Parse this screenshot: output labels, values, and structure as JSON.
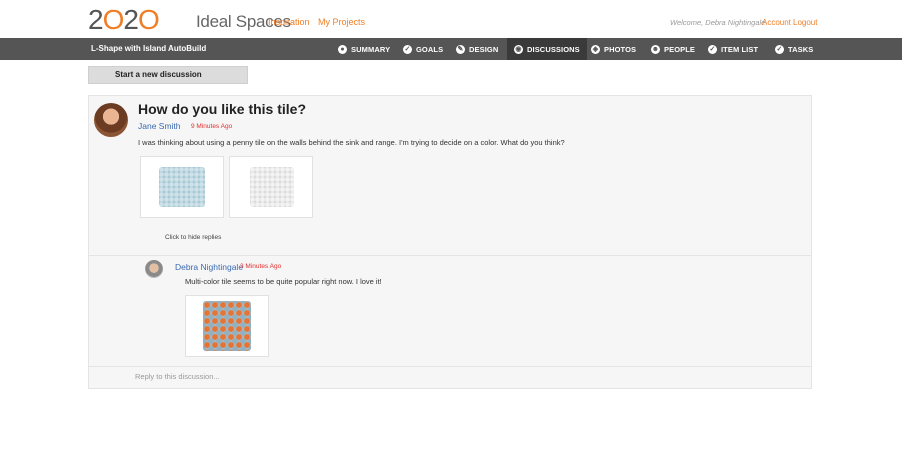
{
  "header": {
    "logo": [
      "2",
      "O",
      "2",
      "O"
    ],
    "brand": "Ideal Spaces",
    "links": [
      "Inspiration",
      "My Projects"
    ],
    "welcome": "Welcome, Debra Nightingale",
    "account": "Account",
    "logout": "Logout"
  },
  "nav": {
    "project": "L-Shape with Island AutoBuild",
    "items": [
      {
        "label": "SUMMARY",
        "icon": "●"
      },
      {
        "label": "GOALS",
        "icon": "✓"
      },
      {
        "label": "DESIGN",
        "icon": "✎"
      },
      {
        "label": "DISCUSSIONS",
        "icon": "◉"
      },
      {
        "label": "PHOTOS",
        "icon": "◈"
      },
      {
        "label": "PEOPLE",
        "icon": "☻"
      },
      {
        "label": "ITEM LIST",
        "icon": "✓"
      },
      {
        "label": "TASKS",
        "icon": "✓"
      }
    ],
    "active": "DISCUSSIONS"
  },
  "actions": {
    "start": "Start a new discussion"
  },
  "discussion": {
    "title": "How do you like this tile?",
    "author": "Jane Smith",
    "time": "9 Minutes Ago",
    "body": "I was thinking about using a penny tile on the walls behind the sink and range. I'm trying to decide on a color.  What do you think?",
    "hide_replies": "Click to hide replies"
  },
  "reply": {
    "author": "Debra Nightingale",
    "time": "3 Minutes Ago",
    "body": "Multi-color tile seems to be quite popular right now. I love it!"
  },
  "reply_box": {
    "placeholder": "Reply to this discussion..."
  },
  "colors": {
    "accent": "#f07e26",
    "nav_bg": "#555555",
    "link": "#3a6ab3",
    "time": "#e0312f"
  }
}
